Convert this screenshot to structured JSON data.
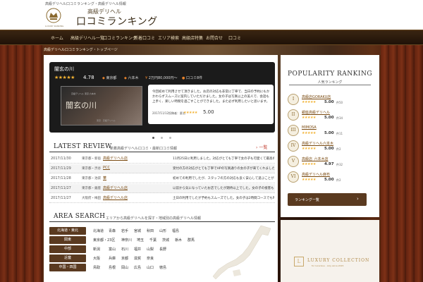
{
  "header": {
    "tagline": "高級デリヘル口コミランキング・高級デリヘル情報",
    "logo_sub": "高級デリヘル",
    "logo_main": "口コミランキング",
    "logo_en": "LUXURY RANKING"
  },
  "nav": {
    "items": [
      "ホーム",
      "高級デリヘル一覧",
      "口コミランキング",
      "新着口コミ",
      "エリア検索",
      "高級店特集",
      "お問合せ",
      "口コミ"
    ]
  },
  "breadcrumb": "高級デリヘル口コミランキング・トップページ",
  "feature": {
    "title": "闇玄の川",
    "stars": "★★★★★",
    "score": "4.78",
    "meta": [
      "東京都",
      "六本木",
      "2万円80,000円〜",
      "口コミ8件"
    ],
    "image_label": "闇玄の川",
    "image_sub": "高級デリヘル 東京 六本木",
    "image_foot": "東京 · 高級デリヘル",
    "text": "今回初めて利用させて頂きました。お店の対応も非常に丁寧で、当日の予約にもかかわらずスムーズに案内していただけました。女の子は写真以上の美人で、会話も上手く、楽しい時間を過ごすことができました。また必ず利用したいと思います。",
    "date": "2017/11/12投稿者：匿名",
    "date_stars": "★★★★★",
    "date_score": "5.00"
  },
  "latest": {
    "title": "LATEST REVIEW",
    "subtitle": "新着高級デリヘル口コミ・最新口コミ情報",
    "more": "一覧",
    "rows": [
      {
        "date": "2017/11/30",
        "area": "東京都・新宿",
        "shop": "高級デリヘル店",
        "text": "11月25日に利用しました。対応がとても丁寧で女の子も可愛くて最高の時間でした。また利用します。"
      },
      {
        "date": "2017/11/29",
        "area": "東京都・渋谷",
        "shop": "PCC",
        "text": "受付の方の対応がとても丁寧でHPの写真通りの女の子が来てくれました。会話も楽しく大満足です。"
      },
      {
        "date": "2017/11/28",
        "area": "東京都・池袋",
        "shop": "華",
        "text": "初めての利用でしたが、スタッフの方の対応も良く安心して遊ぶことができました。おすすめです。"
      },
      {
        "date": "2017/11/27",
        "area": "東京都・銀座",
        "shop": "高級デリヘル店",
        "text": "以前から気になっていたお店でしたが期待以上でした。女の子の接客も素晴らしくリピート確定です。"
      },
      {
        "date": "2017/11/27",
        "area": "大阪府・梅田",
        "shop": "高級デリヘル店",
        "text": "土日の利用でしたが予約もスムーズでした。女の子は2時間コースでも時間を忘れるほど楽しかったです。"
      }
    ]
  },
  "area": {
    "title": "AREA SEARCH",
    "subtitle": "エリアから高級デリヘルを探す・地域別の高級デリヘル情報",
    "regions": [
      {
        "name": "北海道・東北",
        "links": [
          "北海道",
          "青森",
          "岩手",
          "宮城",
          "秋田",
          "山形",
          "福島"
        ]
      },
      {
        "name": "関東",
        "links": [
          "東京都・23区",
          "神奈川",
          "埼玉",
          "千葉",
          "茨城",
          "栃木",
          "群馬"
        ]
      },
      {
        "name": "中部",
        "links": [
          "新潟",
          "富山",
          "石川",
          "福井",
          "山梨",
          "長野"
        ]
      },
      {
        "name": "近畿",
        "links": [
          "大阪",
          "兵庫",
          "京都",
          "滋賀",
          "奈良"
        ]
      },
      {
        "name": "中国・四国",
        "links": [
          "鳥取",
          "島根",
          "岡山",
          "広島",
          "山口",
          "徳島"
        ]
      }
    ]
  },
  "ranking": {
    "title": "POPULARITY RANKING",
    "subtitle": "人気ランキング",
    "items": [
      {
        "badge": "I",
        "name": "高級店GORAKU店",
        "stars": "★★★★★",
        "score": "5.00",
        "count": "件50"
      },
      {
        "badge": "II",
        "name": "銀座高級デリヘル",
        "stars": "★★★★★",
        "score": "5.00",
        "count": "件34"
      },
      {
        "badge": "III",
        "name": "MIMOSA",
        "stars": "★★★★★",
        "score": "5.00",
        "count": "件11"
      },
      {
        "badge": "IV",
        "name": "高級デリヘル六本木",
        "stars": "★★★★★",
        "score": "5.00",
        "count": "件2"
      },
      {
        "badge": "V",
        "name": "高級店_六本木店",
        "stars": "★★★★★",
        "score": "4.97",
        "count": "件32"
      },
      {
        "badge": "VI",
        "name": "高級デリヘル麻布",
        "stars": "★★★★★",
        "score": "5.00",
        "count": "件2"
      }
    ],
    "button": "ランキング一覧"
  },
  "banner": {
    "logo": "L",
    "text": "LUXURY COLLECTION",
    "sub": "for luxurious · only since 2015"
  },
  "colors": {
    "accent": "#5a3a20",
    "star": "#f2b233",
    "link": "#7a4a10"
  }
}
